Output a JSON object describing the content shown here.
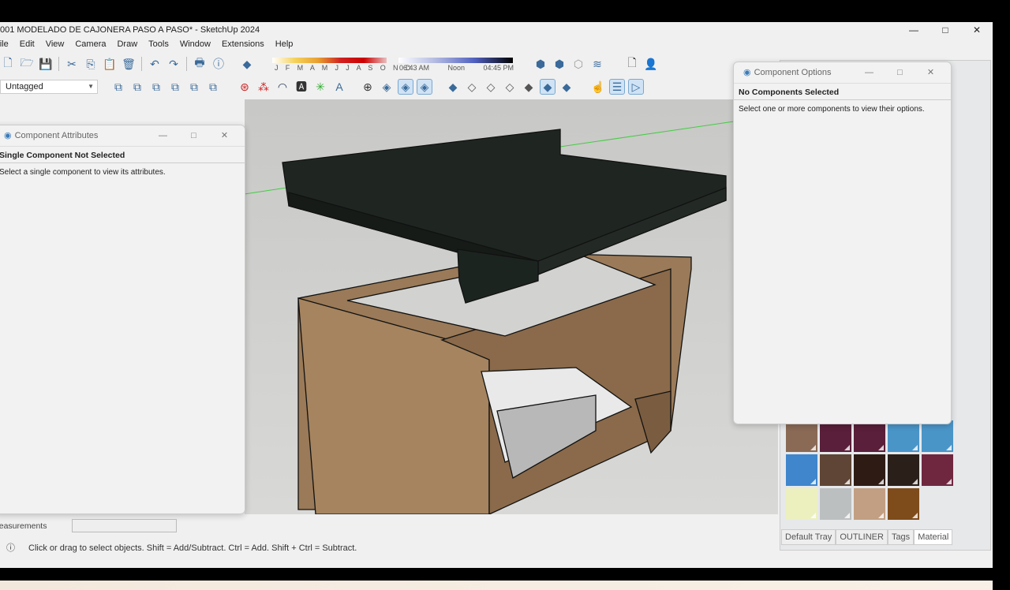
{
  "window": {
    "title": "001 MODELADO DE CAJONERA PASO A PASO* - SketchUp 2024",
    "minimize": "—",
    "maximize": "□",
    "close": "✕"
  },
  "menu": [
    "File",
    "Edit",
    "View",
    "Camera",
    "Draw",
    "Tools",
    "Window",
    "Extensions",
    "Help"
  ],
  "tag_select": {
    "value": "Untagged"
  },
  "shadows": {
    "months": "J F M A M J J A S O N D",
    "time_start": "06:43 AM",
    "time_mid": "Noon",
    "time_end": "04:45 PM",
    "month_fraction": 0.88,
    "time_fraction": 0.68
  },
  "component_attributes": {
    "title": "Component Attributes",
    "heading": "Single Component Not Selected",
    "message": "Select a single component to view its attributes."
  },
  "component_options": {
    "title": "Component Options",
    "heading": "No Components Selected",
    "message": "Select one or more components to view their options."
  },
  "materials": {
    "swatches": [
      "#8a6a55",
      "#5a1f3a",
      "#5a1f3a",
      "#4a95c8",
      "#4a95c8",
      "#3f86cc",
      "#5f4535",
      "#2e1c14",
      "#2a2019",
      "#6f2740",
      "#ecf0bf",
      "#bcbfc0",
      "#c29f82",
      "#7e4c1a"
    ]
  },
  "tray_tabs": [
    "Default Tray",
    "OUTLINER",
    "Tags",
    "Material"
  ],
  "measurements": {
    "label": "Measurements",
    "value": ""
  },
  "status": {
    "text": "Click or drag to select objects. Shift = Add/Subtract. Ctrl = Add. Shift + Ctrl = Subtract."
  }
}
